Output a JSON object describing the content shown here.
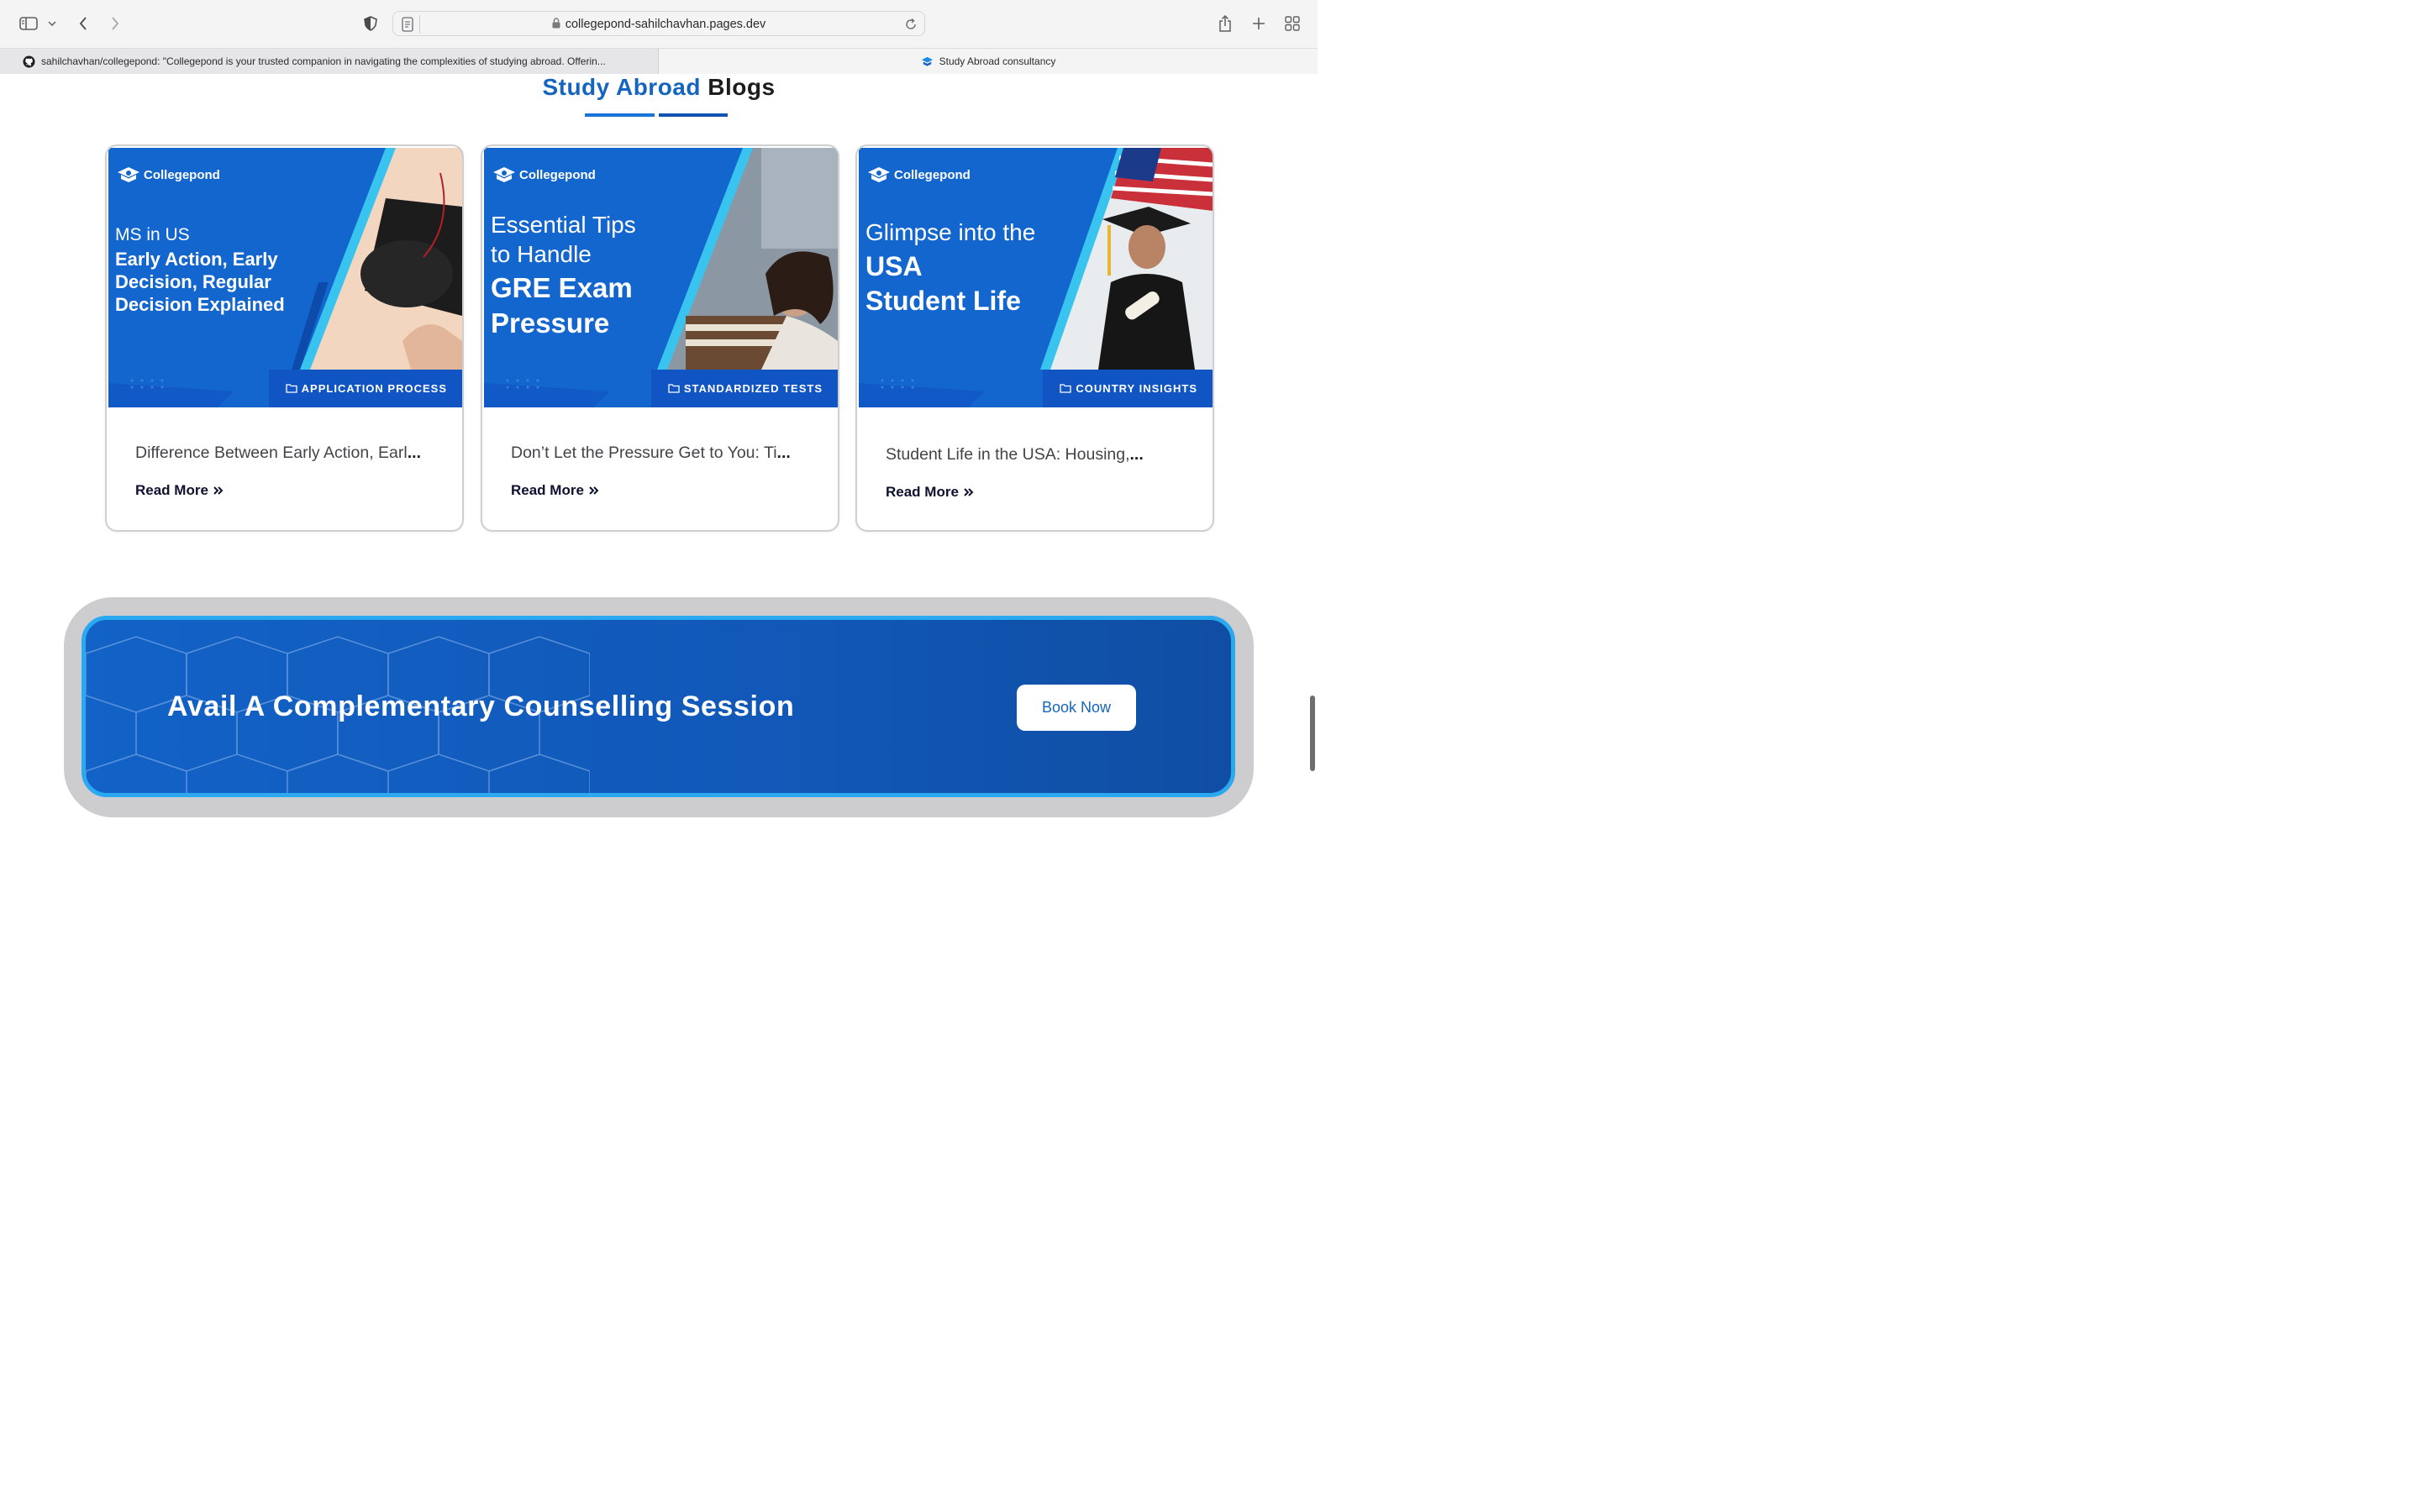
{
  "browser": {
    "url": "collegepond-sahilchavhan.pages.dev",
    "tabs": [
      {
        "label": "sahilchavhan/collegepond: \"Collegepond is your trusted companion in navigating the complexities of studying abroad. Offerin...",
        "active": false,
        "icon": "github-icon"
      },
      {
        "label": "Study Abroad consultancy",
        "active": true,
        "icon": "collegepond-icon"
      }
    ]
  },
  "section": {
    "title_accent": "Study Abroad",
    "title_rest": "Blogs",
    "accent_color": "#1565c0"
  },
  "cards": [
    {
      "brand": "Collegepond",
      "thumb_line1": "MS in US",
      "thumb_line2": "Early Action, Early",
      "thumb_line3": "Decision, Regular",
      "thumb_line4": "Decision Explained",
      "category": "APPLICATION PROCESS",
      "title": "Difference Between Early Action, Earl",
      "ellipsis": "...",
      "read_more": "Read More"
    },
    {
      "brand": "Collegepond",
      "thumb_line1": "Essential Tips",
      "thumb_line2": "to Handle",
      "thumb_line3": "GRE Exam",
      "thumb_line4": "Pressure",
      "category": "STANDARDIZED TESTS",
      "title": "Don’t Let the Pressure Get to You: Ti",
      "ellipsis": "...",
      "read_more": "Read More"
    },
    {
      "brand": "Collegepond",
      "thumb_line1": "Glimpse into the",
      "thumb_line2": "USA",
      "thumb_line3": "Student Life",
      "category": "COUNTRY INSIGHTS",
      "title": "Student Life in the USA: Housing,",
      "ellipsis": "...",
      "read_more": "Read More"
    }
  ],
  "cta": {
    "text": "Avail A Complementary Counselling Session",
    "button": "Book Now"
  }
}
